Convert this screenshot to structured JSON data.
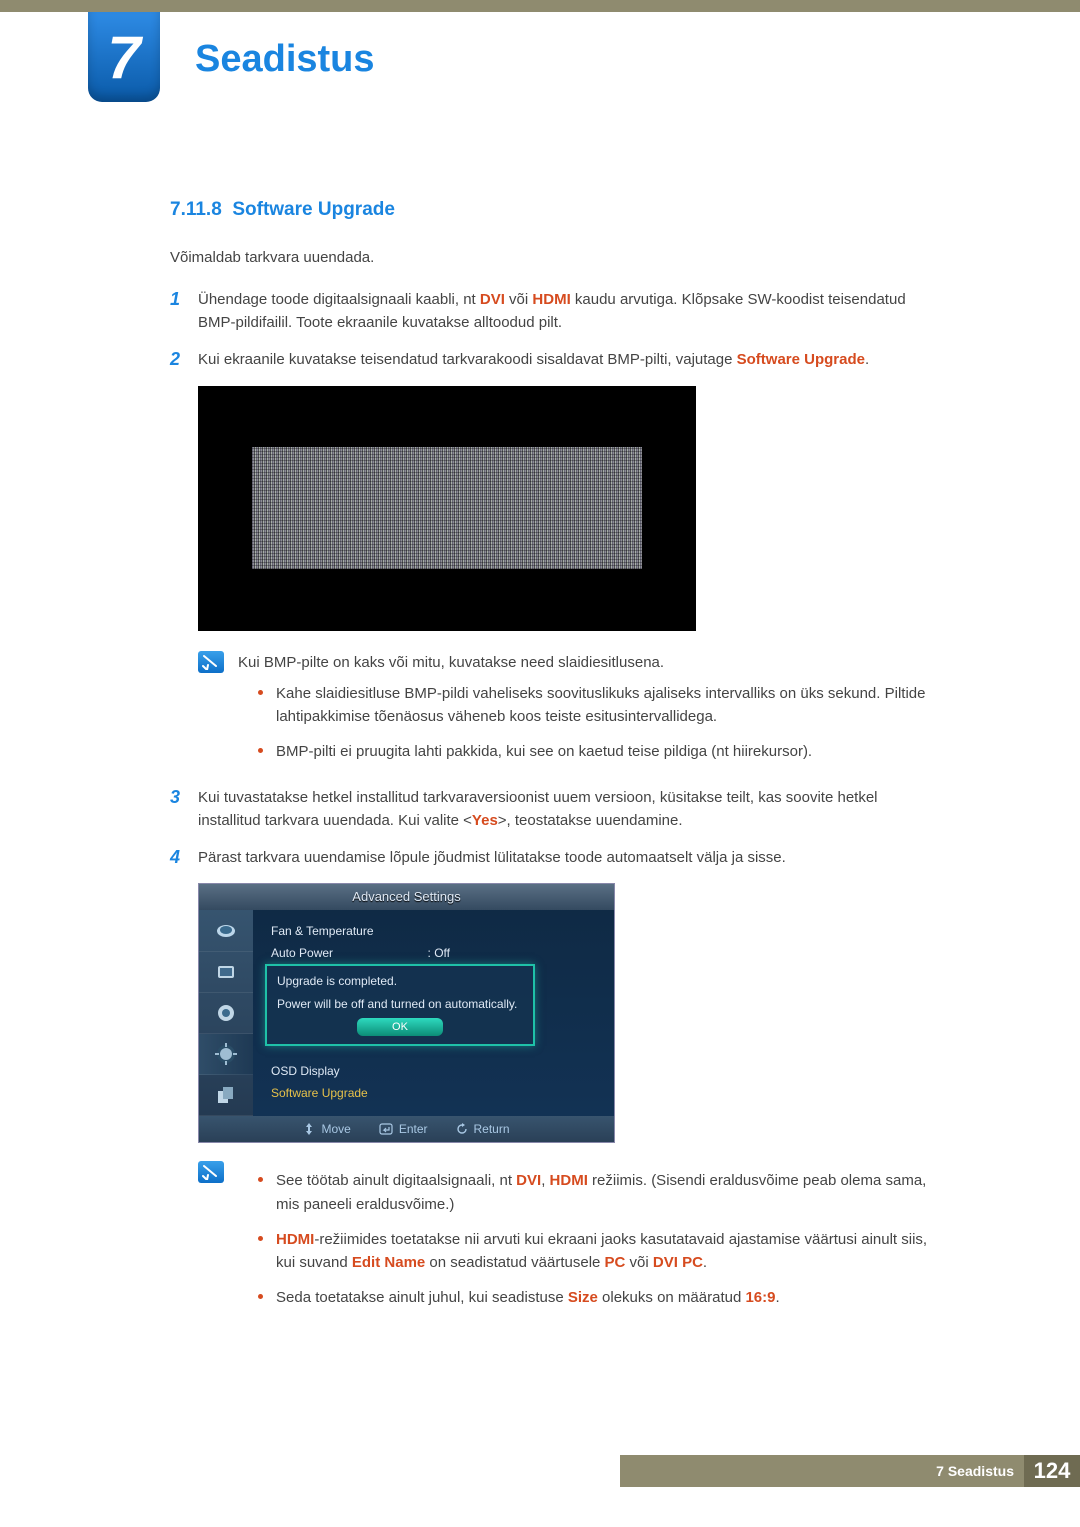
{
  "chapter": {
    "number": "7",
    "title": "Seadistus"
  },
  "section": {
    "number": "7.11.8",
    "title": "Software Upgrade"
  },
  "intro": "Võimaldab tarkvara uuendada.",
  "steps": {
    "s1": {
      "pre": "Ühendage toode digitaalsignaali kaabli, nt ",
      "hi1": "DVI",
      "mid1": " või ",
      "hi2": "HDMI",
      "post": " kaudu arvutiga. Klõpsake SW-koodist teisendatud BMP-pildifailil. Toote ekraanile kuvatakse alltoodud pilt."
    },
    "s2": {
      "pre": "Kui ekraanile kuvatakse teisendatud tarkvarakoodi sisaldavat BMP-pilti, vajutage ",
      "hi": "Software Upgrade",
      "post": "."
    },
    "s3": {
      "pre": "Kui tuvastatakse hetkel installitud tarkvaraversioonist uuem versioon, küsitakse teilt, kas soovite hetkel installitud tarkvara uuendada. Kui valite <",
      "hi": "Yes",
      "post": ">, teostatakse uuendamine."
    },
    "s4": "Pärast tarkvara uuendamise lõpule jõudmist lülitatakse toode automaatselt välja ja sisse."
  },
  "note1": {
    "lead": "Kui BMP-pilte on kaks või mitu, kuvatakse need slaidiesitlusena.",
    "b1": "Kahe slaidiesitluse BMP-pildi vaheliseks soovituslikuks ajaliseks intervalliks on üks sekund. Piltide lahtipakkimise tõenäosus väheneb koos teiste esitusintervallidega.",
    "b2": "BMP-pilti ei pruugita lahti pakkida, kui see on kaetud teise pildiga (nt hiirekursor)."
  },
  "osd": {
    "title": "Advanced Settings",
    "rows": {
      "fan": "Fan & Temperature",
      "auto": "Auto Power",
      "auto_val": ": Off",
      "osd_disp": "OSD Display",
      "sw_up": "Software Upgrade"
    },
    "dialog": {
      "l1": "Upgrade is completed.",
      "l2": "Power will be off and turned on automatically.",
      "ok": "OK"
    },
    "footer": {
      "move": "Move",
      "enter": "Enter",
      "return": "Return"
    }
  },
  "note2": {
    "b1": {
      "pre": "See töötab ainult digitaalsignaali, nt ",
      "hi1": "DVI",
      "sep": ", ",
      "hi2": "HDMI",
      "post": " režiimis. (Sisendi eraldusvõime peab olema sama, mis paneeli eraldusvõime.)"
    },
    "b2": {
      "hi1": "HDMI",
      "mid1": "-režiimides toetatakse nii arvuti kui ekraani jaoks kasutatavaid ajastamise väärtusi ainult siis, kui suvand ",
      "hi2": "Edit Name",
      "mid2": " on seadistatud väärtusele ",
      "hi3": "PC",
      "mid3": " või ",
      "hi4": "DVI PC",
      "post": "."
    },
    "b3": {
      "pre": "Seda toetatakse ainult juhul, kui seadistuse ",
      "hi1": "Size",
      "mid": " olekuks on määratud ",
      "hi2": "16:9",
      "post": "."
    }
  },
  "footer": {
    "chapter": "7 Seadistus",
    "page": "124"
  }
}
